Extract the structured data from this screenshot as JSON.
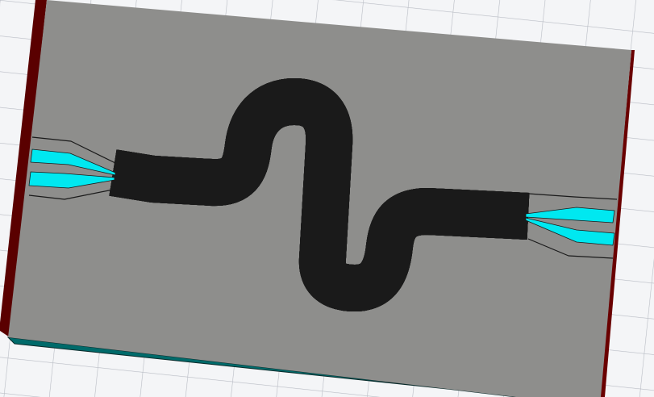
{
  "colors": {
    "background": "#f4f5f7",
    "grid": "#b8bcc4",
    "board_top": "#8e8e8c",
    "board_side": "#5a0000",
    "board_front": "#006a6a",
    "trace": "#00e8f0",
    "outline": "#1a1a1a"
  }
}
